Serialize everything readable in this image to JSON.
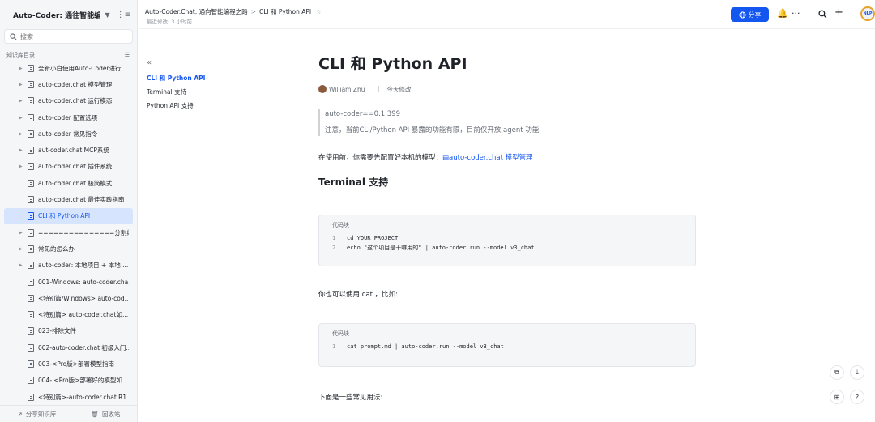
{
  "sidebar": {
    "title": "Auto-Coder: 通往智能编码...",
    "search_placeholder": "搜索",
    "section_label": "知识库目录",
    "items": [
      {
        "label": "全新小白使用Auto-Coder进行...",
        "has_arrow": true,
        "active": false
      },
      {
        "label": "auto-coder.chat 模型管理",
        "has_arrow": true,
        "active": false
      },
      {
        "label": "auto-coder.chat 运行模态",
        "has_arrow": true,
        "active": false
      },
      {
        "label": "auto-coder 配置选项",
        "has_arrow": true,
        "active": false
      },
      {
        "label": "auto-coder 常见指令",
        "has_arrow": true,
        "active": false
      },
      {
        "label": "aut-coder.chat MCP系统",
        "has_arrow": true,
        "active": false
      },
      {
        "label": "auto-coder.chat 插件系统",
        "has_arrow": true,
        "active": false
      },
      {
        "label": "auto-coder.chat 极简模式",
        "has_arrow": false,
        "active": false
      },
      {
        "label": "auto-coder.chat 最佳实践指南",
        "has_arrow": false,
        "active": false
      },
      {
        "label": "CLI 和 Python API",
        "has_arrow": false,
        "active": true
      },
      {
        "label": "===============分割线=...",
        "has_arrow": true,
        "active": false
      },
      {
        "label": "常见的怎么办",
        "has_arrow": true,
        "active": false
      },
      {
        "label": "auto-coder: 本地项目 + 本地 ...",
        "has_arrow": true,
        "active": false
      },
      {
        "label": "001-Windows: auto-coder.cha...",
        "has_arrow": false,
        "active": false
      },
      {
        "label": "<特别篇/Windows> auto-cod...",
        "has_arrow": false,
        "active": false
      },
      {
        "label": "<特别篇> auto-coder.chat如...",
        "has_arrow": false,
        "active": false
      },
      {
        "label": "023-排除文件",
        "has_arrow": false,
        "active": false
      },
      {
        "label": "002-auto-coder.chat 初级入门...",
        "has_arrow": false,
        "active": false
      },
      {
        "label": "003-<Pro版>部署模型指南",
        "has_arrow": false,
        "active": false
      },
      {
        "label": "004- <Pro版>部署好的模型如...",
        "has_arrow": false,
        "active": false
      },
      {
        "label": "<特别篇>-auto-coder.chat R1...",
        "has_arrow": false,
        "active": false
      }
    ],
    "footer": {
      "share_label": "分享知识库",
      "trash_label": "回收站"
    }
  },
  "topbar": {
    "breadcrumb_root": "Auto-Coder.Chat: 通向智能编程之路",
    "breadcrumb_current": "CLI 和 Python API",
    "modified": "最近修改: 3 小时前",
    "share_label": "分享",
    "avatar_text": "NLP"
  },
  "toc": {
    "items": [
      {
        "label": "CLI 和 Python API",
        "active": true
      },
      {
        "label": "Terminal 支持",
        "active": false
      },
      {
        "label": "Python API 支持",
        "active": false
      }
    ]
  },
  "doc": {
    "title": "CLI 和 Python API",
    "author": "William Zhu",
    "edited": "今天修改",
    "quote_line1": "auto-coder==0.1.399",
    "quote_line2": "注意，当前CLI/Python API 暴露的功能有限，目前仅开放 agent 功能",
    "para1_prefix": "在使用前，你需要先配置好本机的模型：",
    "para1_link": "auto-coder.chat 模型管理",
    "heading_terminal": "Terminal 支持",
    "code1": {
      "label": "代码块",
      "lines": [
        {
          "n": "1",
          "code": "cd YOUR_PROJECT"
        },
        {
          "n": "2",
          "code": "echo \"这个项目是干嘛用的\" | auto-coder.run --model v3_chat"
        }
      ]
    },
    "para2": "你也可以使用 cat ，比如:",
    "code2": {
      "label": "代码块",
      "lines": [
        {
          "n": "1",
          "code": "cat prompt.md | auto-coder.run --model v3_chat"
        }
      ]
    },
    "para3": "下面是一些常见用法:"
  },
  "colors": {
    "accent": "#1456f0",
    "active_bg": "#d6e4fd",
    "sidebar_bg": "#f5f6f7"
  }
}
